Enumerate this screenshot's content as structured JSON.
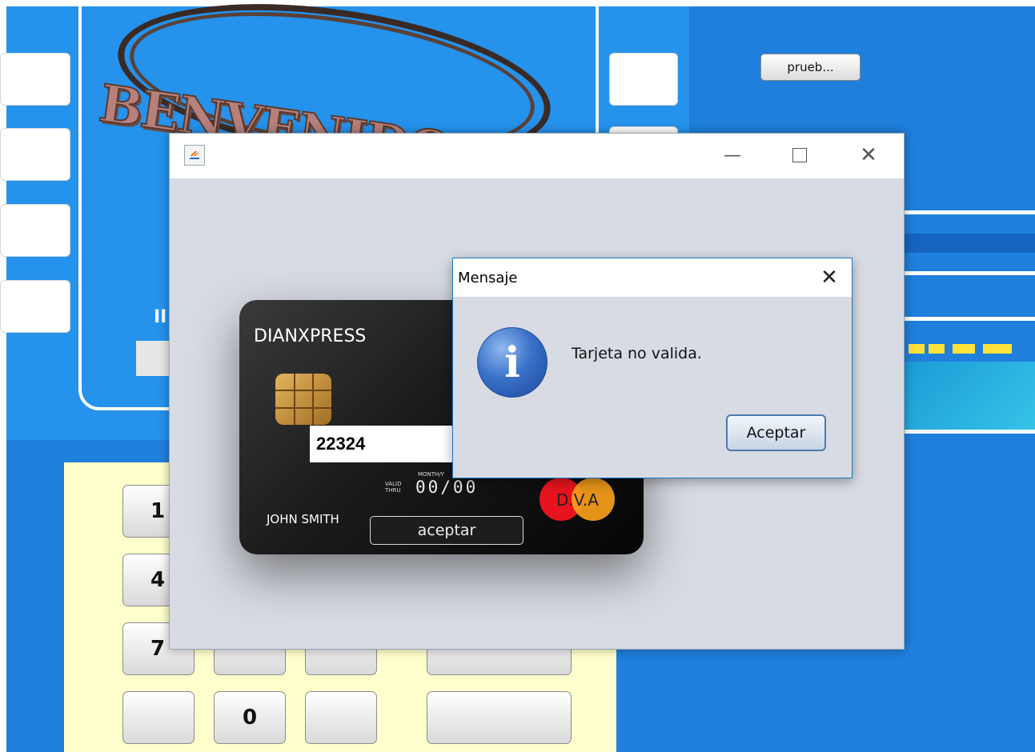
{
  "background_app": {
    "top_button_label": "prueb...",
    "logo_text": "BENVENIDO",
    "partial_text_left": "II",
    "keypad_keys": [
      "1",
      "4",
      "7",
      "",
      "0",
      ""
    ]
  },
  "card_window": {
    "card": {
      "brand": "DIANXPRESS",
      "card_number_value": "22324",
      "valid_thru_label": "VALID THRU",
      "month_year_label": "MONTH/Y",
      "expiry": "00/00",
      "holder_name": "JOHN SMITH",
      "logo_text": "D.V.A",
      "accept_button_label": "aceptar"
    }
  },
  "dialog": {
    "title": "Mensaje",
    "message": "Tarjeta no valida.",
    "ok_button_label": "Aceptar"
  },
  "colors": {
    "atm_blue": "#1f7fdc",
    "atm_panel_blue": "#2592ec",
    "keypad_bg": "#ffffcd",
    "window_bg": "#d8dbe3",
    "dialog_border": "#1979ca"
  }
}
